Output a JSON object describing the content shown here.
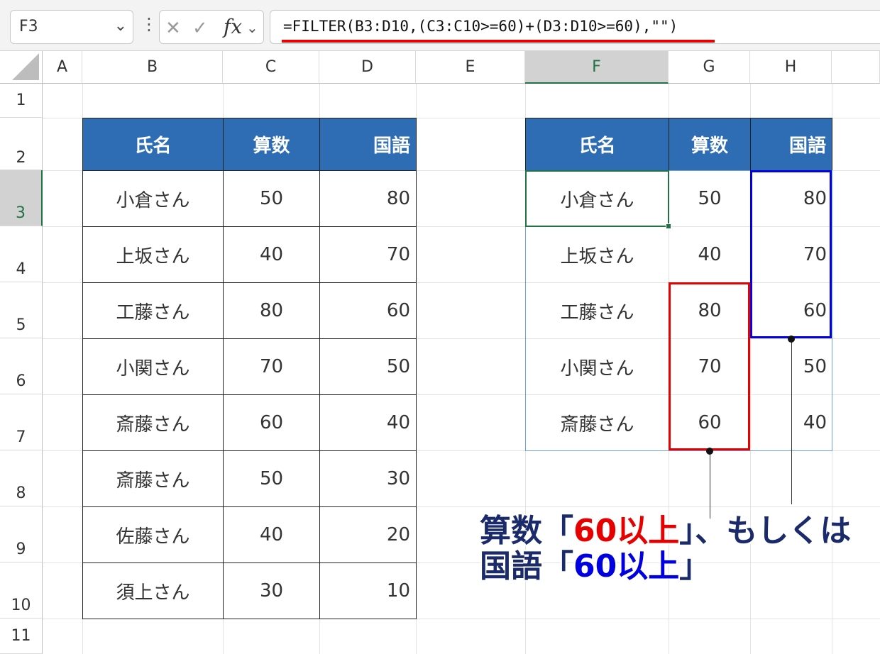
{
  "formula_bar": {
    "name_box": "F3",
    "formula": "=FILTER(B3:D10,(C3:C10>=60)+(D3:D10>=60),\"\")"
  },
  "columns": [
    "A",
    "B",
    "C",
    "D",
    "E",
    "F",
    "G",
    "H"
  ],
  "rows": [
    "1",
    "2",
    "3",
    "4",
    "5",
    "6",
    "7",
    "8",
    "9",
    "10",
    "11"
  ],
  "selected_column": "F",
  "selected_row": "3",
  "source_table": {
    "headers": [
      "氏名",
      "算数",
      "国語"
    ],
    "rows": [
      [
        "小倉さん",
        "50",
        "80"
      ],
      [
        "上坂さん",
        "40",
        "70"
      ],
      [
        "工藤さん",
        "80",
        "60"
      ],
      [
        "小関さん",
        "70",
        "50"
      ],
      [
        "斎藤さん",
        "60",
        "40"
      ],
      [
        "斎藤さん",
        "50",
        "30"
      ],
      [
        "佐藤さん",
        "40",
        "20"
      ],
      [
        "須上さん",
        "30",
        "10"
      ]
    ]
  },
  "result_table": {
    "headers": [
      "氏名",
      "算数",
      "国語"
    ],
    "rows": [
      [
        "小倉さん",
        "50",
        "80"
      ],
      [
        "上坂さん",
        "40",
        "70"
      ],
      [
        "工藤さん",
        "80",
        "60"
      ],
      [
        "小関さん",
        "70",
        "50"
      ],
      [
        "斎藤さん",
        "60",
        "40"
      ]
    ]
  },
  "callout": {
    "line1_prefix": "算数「",
    "line1_highlight": "60以上",
    "line1_suffix": "」、もしくは",
    "line2_prefix": "国語「",
    "line2_highlight": "60以上",
    "line2_suffix": "」"
  },
  "colors": {
    "header_fill": "#2e6db4",
    "accent_green": "#217346",
    "highlight_red": "#e60000",
    "highlight_blue": "#0000e0",
    "callout_text": "#1a2a6b"
  }
}
